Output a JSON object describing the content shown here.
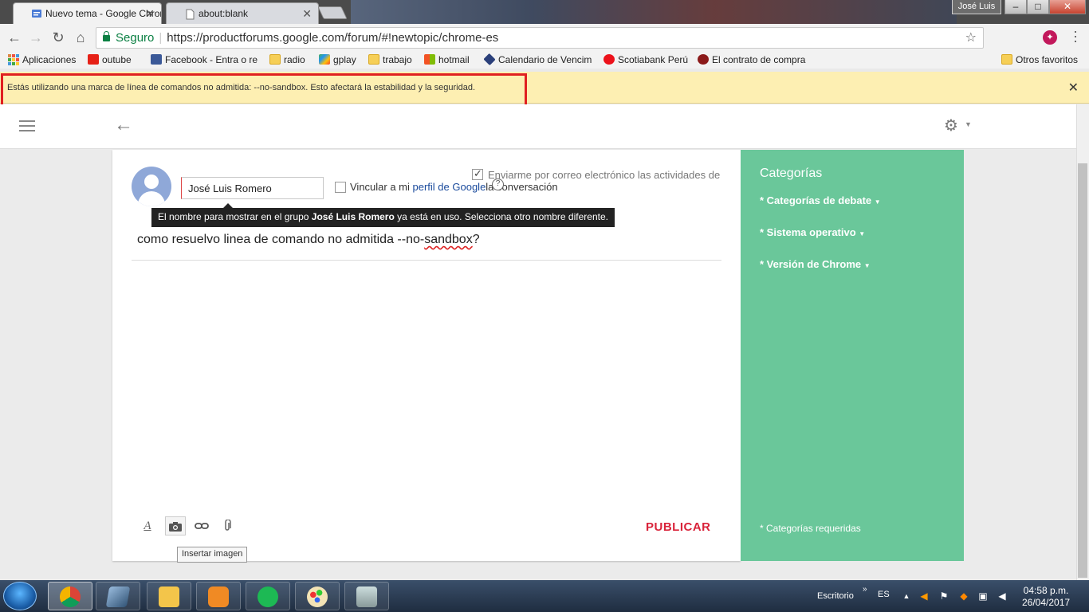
{
  "browser": {
    "tabs": [
      {
        "title": "Nuevo tema - Google Chrome",
        "active": true
      },
      {
        "title": "about:blank",
        "active": false
      }
    ],
    "user_badge": "José Luis",
    "window_controls": {
      "minimize": "–",
      "maximize": "□",
      "close": "✕"
    },
    "omnibox": {
      "secure_label": "Seguro",
      "url": "https://productforums.google.com/forum/#!newtopic/chrome-es"
    },
    "bookmarks": [
      {
        "label": "Aplicaciones",
        "icon": "apps-grid-icon"
      },
      {
        "label": "outube",
        "icon": "youtube-icon"
      },
      {
        "label": "Facebook - Entra o re",
        "icon": "facebook-icon"
      },
      {
        "label": "radio",
        "icon": "folder-icon"
      },
      {
        "label": "gplay",
        "icon": "gplay-icon"
      },
      {
        "label": "trabajo",
        "icon": "folder-icon"
      },
      {
        "label": "hotmail",
        "icon": "windows-icon"
      },
      {
        "label": "Calendario de Vencim",
        "icon": "calendar-icon"
      },
      {
        "label": "Scotiabank Perú",
        "icon": "scotiabank-icon"
      },
      {
        "label": "El contrato de compra",
        "icon": "contract-icon"
      },
      {
        "label": "Otros favoritos",
        "icon": "folder-icon"
      }
    ],
    "infobar": {
      "message": "Estás utilizando una marca de línea de comandos no admitida: --no-sandbox. Esto afectará la estabilidad y la seguridad.",
      "close": "✕"
    }
  },
  "forum": {
    "name_value": "José Luis Romero",
    "link_profile": {
      "prefix": "Vincular a mi ",
      "link": "perfil de Google",
      "suffix": "la conversación"
    },
    "email_notify": "Enviarme por correo electrónico las actividades de",
    "name_tooltip": {
      "prefix": "El nombre para mostrar en el grupo ",
      "name": "José Luis Romero",
      "suffix": " ya está en uso. Selecciona otro nombre diferente."
    },
    "subject_parts": {
      "before": "como resuelvo linea de comando no admitida --no-",
      "misspelled": "sandbox",
      "after": "?"
    },
    "image_tooltip": "Insertar imagen",
    "publish_label": "PUBLICAR"
  },
  "categories": {
    "title": "Categorías",
    "items": [
      "Categorías de debate",
      "Sistema operativo",
      "Versión de Chrome"
    ],
    "footer": "* Categorías requeridas"
  },
  "taskbar": {
    "desktop_label": "Escritorio",
    "language": "ES",
    "time": "04:58 p.m.",
    "date": "26/04/2017"
  }
}
